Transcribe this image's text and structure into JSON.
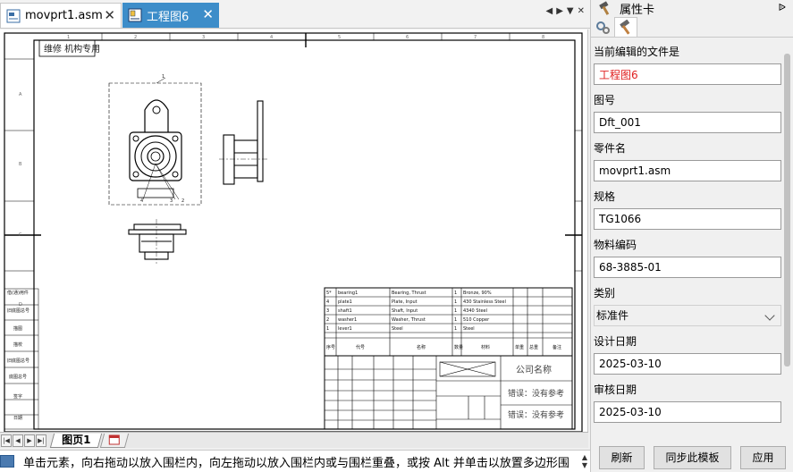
{
  "tabs": [
    {
      "label": "movprt1.asm",
      "active": false
    },
    {
      "label": "工程图6",
      "active": true
    }
  ],
  "drawing": {
    "title_block_top_label": "维修 机构专用",
    "col_markers": [
      "1",
      "2",
      "3",
      "4",
      "5",
      "6",
      "7",
      "8"
    ],
    "row_markers": [
      "A",
      "B",
      "C",
      "D"
    ],
    "balloon_numbers": [
      "1",
      "2",
      "3",
      "4"
    ],
    "bom_rows": [
      {
        "no": "5*",
        "code": "bearing1",
        "name": "Bearing, Thrust",
        "qty": "1",
        "material": "Bronze, 90%"
      },
      {
        "no": "4",
        "code": "plate1",
        "name": "Plate, Input",
        "qty": "1",
        "material": "430 Stainless Steel"
      },
      {
        "no": "3",
        "code": "shaft1",
        "name": "Shaft, Input",
        "qty": "1",
        "material": "4340 Steel"
      },
      {
        "no": "2",
        "code": "washer1",
        "name": "Washer, Thrust",
        "qty": "1",
        "material": "510 Copper"
      },
      {
        "no": "1",
        "code": "lever1",
        "name": "Steel",
        "qty": "1",
        "material": "Steel"
      }
    ],
    "bom_header": [
      "序号",
      "代号",
      "名称",
      "数量",
      "材料",
      "单重",
      "总重",
      "备注"
    ],
    "company_name": "公司名称",
    "error_text_1": "错误：没有参考",
    "error_text_2": "错误：没有参考",
    "left_labels": [
      "借(通)用件",
      "旧底图总号",
      "描图",
      "描校",
      "旧底图总号",
      "底图总号",
      "签字",
      "日期"
    ]
  },
  "sheet_tabs": {
    "label": "图页1"
  },
  "status": {
    "text": "单击元素，向右拖动以放入围栏内，向左拖动以放入围栏内或与围栏重叠，或按 Alt 并单击以放置多边形围"
  },
  "panel": {
    "title": "属性卡",
    "pin": "ᐉ",
    "fields": [
      {
        "label": "当前编辑的文件是",
        "value": "工程图6",
        "type": "input",
        "red": true
      },
      {
        "label": "图号",
        "value": "Dft_001",
        "type": "input"
      },
      {
        "label": "零件名",
        "value": "movprt1.asm",
        "type": "input"
      },
      {
        "label": "规格",
        "value": "TG1066",
        "type": "input"
      },
      {
        "label": "物料编码",
        "value": "68-3885-01",
        "type": "input"
      },
      {
        "label": "类别",
        "value": "标准件",
        "type": "select"
      },
      {
        "label": "设计日期",
        "value": "2025-03-10",
        "type": "input"
      },
      {
        "label": "审核日期",
        "value": "2025-03-10",
        "type": "input"
      }
    ],
    "buttons": {
      "refresh": "刷新",
      "sync": "同步此模板",
      "apply": "应用"
    }
  }
}
